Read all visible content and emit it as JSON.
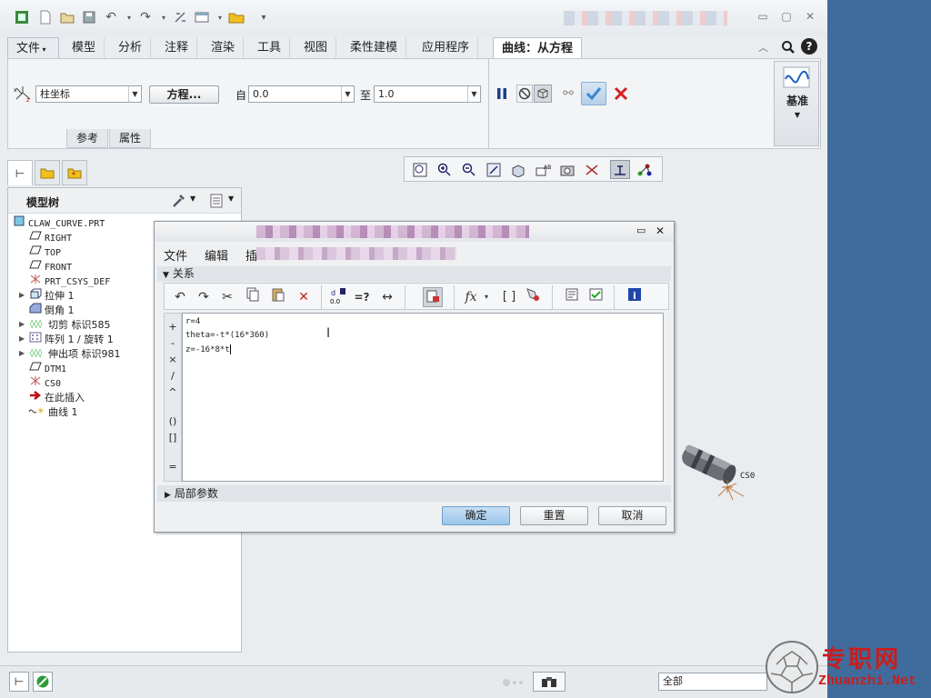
{
  "quick_access": {
    "icons": [
      "new-icon",
      "open-icon",
      "save-icon",
      "undo-icon",
      "redo-icon",
      "regenerate-icon",
      "windows-icon",
      "folder-icon",
      "customize-icon"
    ]
  },
  "ribbon": {
    "tabs": [
      "文件",
      "模型",
      "分析",
      "注释",
      "渲染",
      "工具",
      "视图",
      "柔性建模",
      "应用程序",
      "曲线：从方程"
    ],
    "coordinate_type": "柱坐标",
    "equation_button": "方程...",
    "from_label": "自",
    "from_value": "0.0",
    "to_label": "至",
    "to_value": "1.0",
    "subtabs": [
      "参考",
      "属性"
    ],
    "datum_label": "基准"
  },
  "model_tree": {
    "tabs": [
      "model-tree-tab",
      "folder-browser-tab",
      "favorites-tab"
    ],
    "title": "模型树",
    "items": [
      {
        "label": "CLAW_CURVE.PRT",
        "icon": "part-icon",
        "expandable": false,
        "mono": true
      },
      {
        "label": "RIGHT",
        "icon": "datum-plane-icon",
        "expandable": false,
        "mono": true
      },
      {
        "label": "TOP",
        "icon": "datum-plane-icon",
        "expandable": false,
        "mono": true
      },
      {
        "label": "FRONT",
        "icon": "datum-plane-icon",
        "expandable": false,
        "mono": true
      },
      {
        "label": "PRT_CSYS_DEF",
        "icon": "csys-icon",
        "expandable": false,
        "mono": true
      },
      {
        "label": "拉伸 1",
        "icon": "extrude-icon",
        "expandable": true,
        "mono": false
      },
      {
        "label": "倒角 1",
        "icon": "chamfer-icon",
        "expandable": false,
        "mono": false
      },
      {
        "label": "切剪 标识585",
        "icon": "cut-icon",
        "expandable": true,
        "mono": false
      },
      {
        "label": "阵列 1 / 旋转 1",
        "icon": "pattern-icon",
        "expandable": true,
        "mono": false
      },
      {
        "label": "伸出项 标识981",
        "icon": "protrusion-icon",
        "expandable": true,
        "mono": false
      },
      {
        "label": "DTM1",
        "icon": "datum-plane-icon",
        "expandable": false,
        "mono": true
      },
      {
        "label": "CS0",
        "icon": "csys-icon",
        "expandable": false,
        "mono": true
      },
      {
        "label": "在此插入",
        "icon": "insert-arrow-icon",
        "expandable": false,
        "mono": false
      },
      {
        "label": "曲线 1",
        "icon": "curve-icon",
        "expandable": false,
        "mono": false
      }
    ]
  },
  "dialog": {
    "menus": [
      "文件",
      "编辑",
      "插"
    ],
    "section": "关系",
    "operators": [
      "+",
      "-",
      "×",
      "/",
      "^",
      "()",
      "[]",
      "="
    ],
    "relations": [
      "r=4",
      "theta=-t*(16*360)",
      "z=-16*8*t"
    ],
    "local_params": "局部参数",
    "ok": "确定",
    "reset": "重置",
    "cancel": "取消"
  },
  "graphic_label": "CS0",
  "statusbar": {
    "filter": "全部"
  },
  "watermark": {
    "cn": "专职网",
    "url": "Zhuanzhi.Net"
  },
  "colors": {
    "accent_blue": "#3f6c9c",
    "ok_button": "#9cc6ea",
    "cancel_red": "#d42020",
    "watermark_red": "#c81e1e"
  }
}
